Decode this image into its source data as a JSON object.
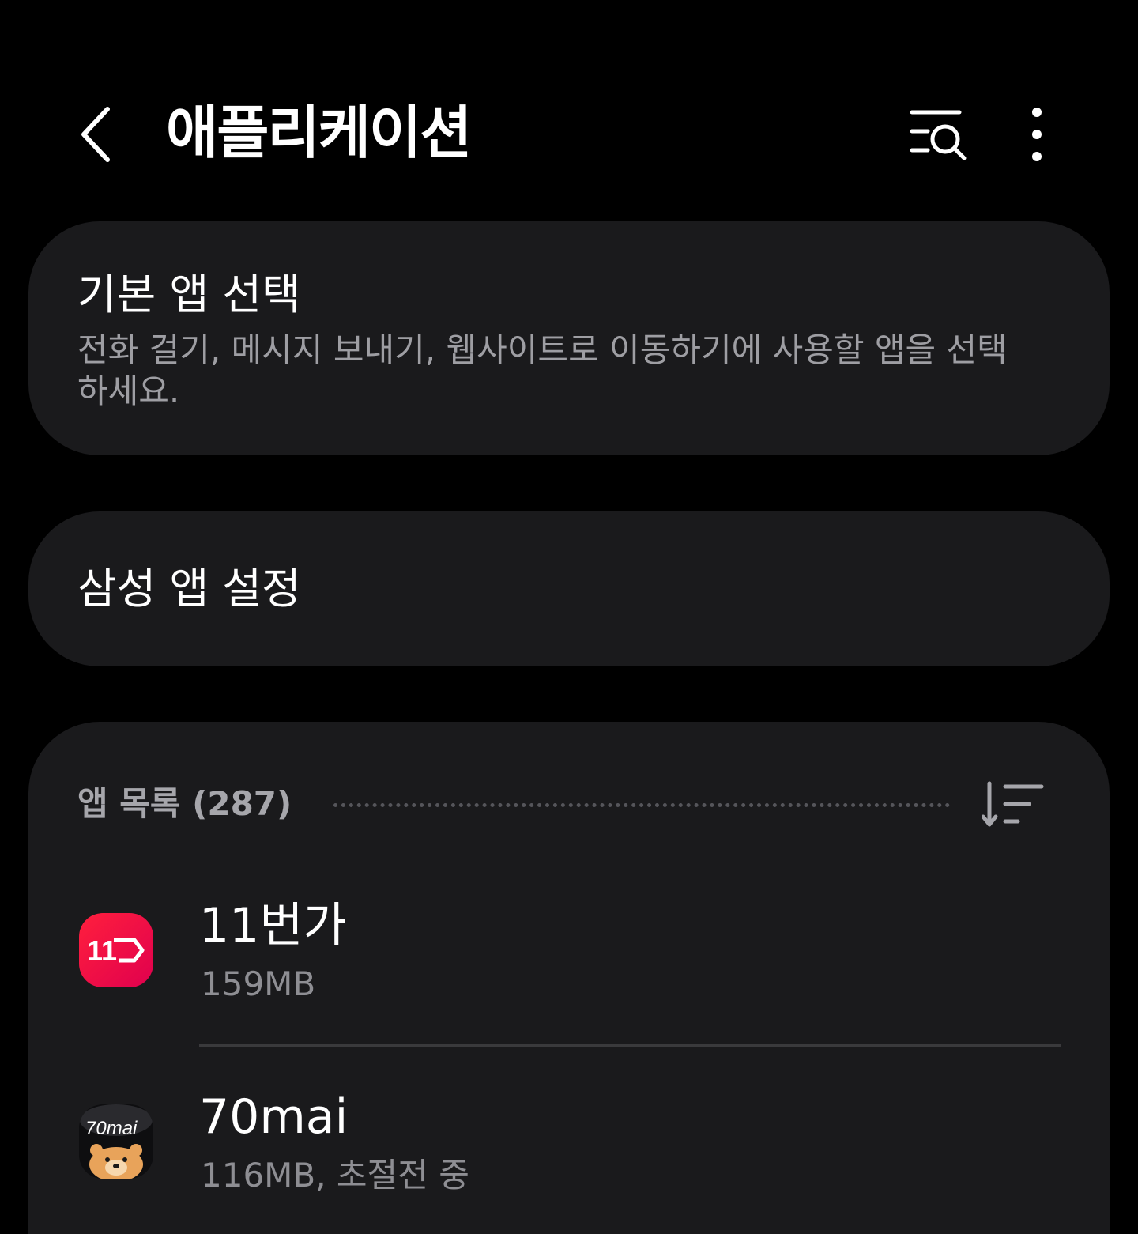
{
  "header": {
    "title": "애플리케이션",
    "back_icon": "back-arrow-icon",
    "search_icon": "list-search-icon",
    "more_icon": "more-vertical-icon"
  },
  "default_apps": {
    "title": "기본 앱 선택",
    "description": "전화 걸기, 메시지 보내기, 웹사이트로 이동하기에 사용할 앱을 선택하세요."
  },
  "samsung_apps": {
    "title": "삼성 앱 설정"
  },
  "app_list": {
    "header": "앱 목록 (287)",
    "sort_icon": "sort-icon",
    "items": [
      {
        "name": "11번가",
        "size": "159MB",
        "icon": "11st-app-icon",
        "icon_label": "11",
        "color": "#ff1f3d"
      },
      {
        "name": "70mai",
        "size": "116MB, 초절전 중",
        "icon": "70mai-app-icon",
        "icon_label": "70mai",
        "color": "#0e0e10"
      }
    ]
  },
  "colors": {
    "background": "#000000",
    "card": "#1a1a1c",
    "secondary_text": "#9e9ea3"
  }
}
